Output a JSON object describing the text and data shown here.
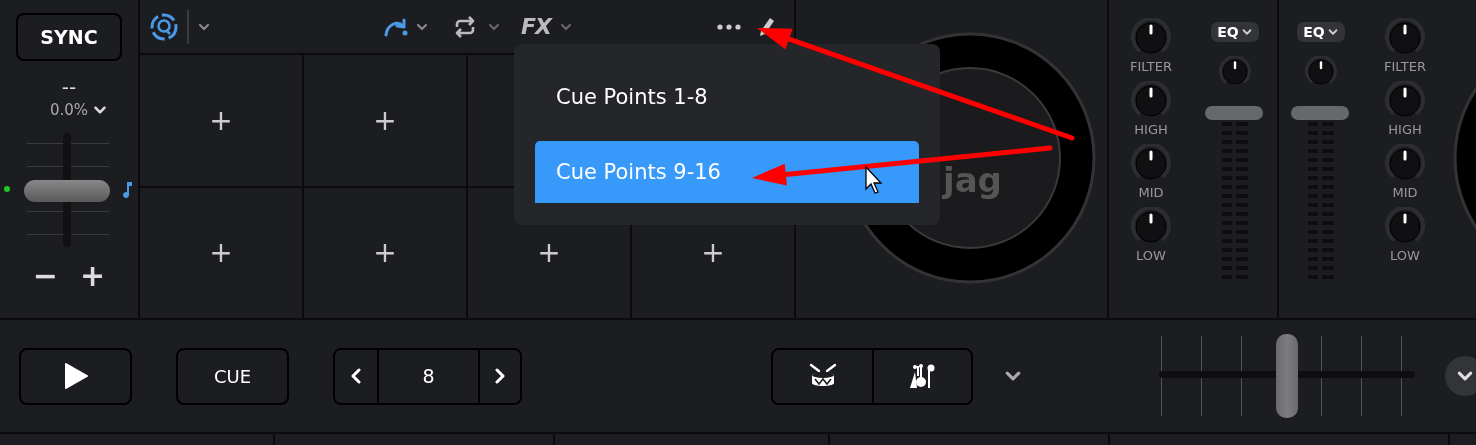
{
  "deck": {
    "sync": "SYNC",
    "bpm": "--",
    "pitch": "0.0%",
    "pitch_slider": {
      "level": 0.5
    },
    "minus": "−",
    "plus": "+"
  },
  "pad_toolbar": {
    "fx": "FX"
  },
  "pad_rows": [
    [
      {
        "label": "+"
      },
      {
        "label": "+"
      }
    ],
    [
      {
        "label": "+"
      },
      {
        "label": "+"
      },
      {
        "label": "+"
      },
      {
        "label": "+"
      }
    ]
  ],
  "menu": {
    "items": [
      {
        "label": "Cue Points 1-8",
        "selected": false
      },
      {
        "label": "Cue Points 9-16",
        "selected": true
      }
    ]
  },
  "jog": {
    "logo": "jag"
  },
  "mixer": [
    {
      "eq": "EQ",
      "fader": {
        "level": 1
      },
      "knobs": [
        {
          "label": "FILTER"
        },
        {
          "label": "HIGH"
        },
        {
          "label": "MID"
        },
        {
          "label": "LOW"
        }
      ]
    },
    {
      "eq": "EQ",
      "fader": {
        "level": 1
      },
      "knobs": [
        {
          "label": "FILTER"
        },
        {
          "label": "HIGH"
        },
        {
          "label": "MID"
        },
        {
          "label": "LOW"
        }
      ]
    }
  ],
  "transport": {
    "cue": "CUE",
    "loop": {
      "value": "8"
    }
  },
  "crossfader": {
    "level": 0.5
  },
  "annotations": [
    {
      "kind": "arrow"
    },
    {
      "kind": "arrow"
    }
  ]
}
